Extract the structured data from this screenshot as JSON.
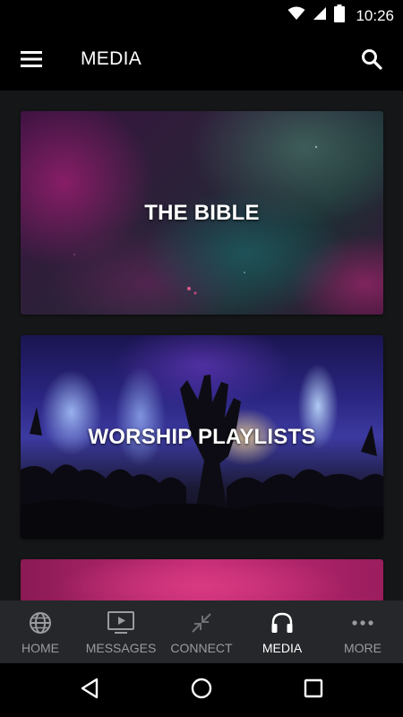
{
  "status_bar": {
    "time": "10:26",
    "icons": [
      "wifi-icon",
      "cell-signal-icon",
      "battery-icon"
    ]
  },
  "app_bar": {
    "title": "MEDIA",
    "menu_icon": "hamburger-menu-icon",
    "search_icon": "search-icon"
  },
  "cards": [
    {
      "title": "THE BIBLE"
    },
    {
      "title": "WORSHIP PLAYLISTS"
    },
    {
      "title": ""
    }
  ],
  "bottom_nav": {
    "items": [
      {
        "label": "HOME",
        "icon": "globe-icon",
        "active": false
      },
      {
        "label": "MESSAGES",
        "icon": "tv-play-icon",
        "active": false
      },
      {
        "label": "CONNECT",
        "icon": "collapse-arrows-icon",
        "active": false
      },
      {
        "label": "MEDIA",
        "icon": "headphones-icon",
        "active": true
      },
      {
        "label": "MORE",
        "icon": "more-dots-icon",
        "active": false
      }
    ],
    "active_color": "#ffffff",
    "inactive_color": "#9a9b9e"
  },
  "system_nav": {
    "buttons": [
      "back-icon",
      "home-circle-icon",
      "recents-square-icon"
    ]
  }
}
